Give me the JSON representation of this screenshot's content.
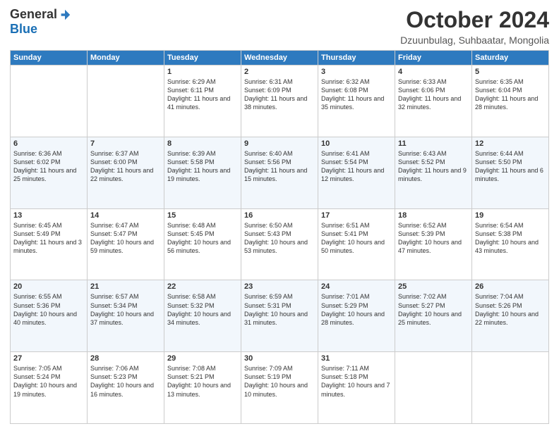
{
  "header": {
    "logo_general": "General",
    "logo_blue": "Blue",
    "month": "October 2024",
    "location": "Dzuunbulag, Suhbaatar, Mongolia"
  },
  "days_of_week": [
    "Sunday",
    "Monday",
    "Tuesday",
    "Wednesday",
    "Thursday",
    "Friday",
    "Saturday"
  ],
  "weeks": [
    [
      {
        "day": "",
        "sunrise": "",
        "sunset": "",
        "daylight": ""
      },
      {
        "day": "",
        "sunrise": "",
        "sunset": "",
        "daylight": ""
      },
      {
        "day": "1",
        "sunrise": "Sunrise: 6:29 AM",
        "sunset": "Sunset: 6:11 PM",
        "daylight": "Daylight: 11 hours and 41 minutes."
      },
      {
        "day": "2",
        "sunrise": "Sunrise: 6:31 AM",
        "sunset": "Sunset: 6:09 PM",
        "daylight": "Daylight: 11 hours and 38 minutes."
      },
      {
        "day": "3",
        "sunrise": "Sunrise: 6:32 AM",
        "sunset": "Sunset: 6:08 PM",
        "daylight": "Daylight: 11 hours and 35 minutes."
      },
      {
        "day": "4",
        "sunrise": "Sunrise: 6:33 AM",
        "sunset": "Sunset: 6:06 PM",
        "daylight": "Daylight: 11 hours and 32 minutes."
      },
      {
        "day": "5",
        "sunrise": "Sunrise: 6:35 AM",
        "sunset": "Sunset: 6:04 PM",
        "daylight": "Daylight: 11 hours and 28 minutes."
      }
    ],
    [
      {
        "day": "6",
        "sunrise": "Sunrise: 6:36 AM",
        "sunset": "Sunset: 6:02 PM",
        "daylight": "Daylight: 11 hours and 25 minutes."
      },
      {
        "day": "7",
        "sunrise": "Sunrise: 6:37 AM",
        "sunset": "Sunset: 6:00 PM",
        "daylight": "Daylight: 11 hours and 22 minutes."
      },
      {
        "day": "8",
        "sunrise": "Sunrise: 6:39 AM",
        "sunset": "Sunset: 5:58 PM",
        "daylight": "Daylight: 11 hours and 19 minutes."
      },
      {
        "day": "9",
        "sunrise": "Sunrise: 6:40 AM",
        "sunset": "Sunset: 5:56 PM",
        "daylight": "Daylight: 11 hours and 15 minutes."
      },
      {
        "day": "10",
        "sunrise": "Sunrise: 6:41 AM",
        "sunset": "Sunset: 5:54 PM",
        "daylight": "Daylight: 11 hours and 12 minutes."
      },
      {
        "day": "11",
        "sunrise": "Sunrise: 6:43 AM",
        "sunset": "Sunset: 5:52 PM",
        "daylight": "Daylight: 11 hours and 9 minutes."
      },
      {
        "day": "12",
        "sunrise": "Sunrise: 6:44 AM",
        "sunset": "Sunset: 5:50 PM",
        "daylight": "Daylight: 11 hours and 6 minutes."
      }
    ],
    [
      {
        "day": "13",
        "sunrise": "Sunrise: 6:45 AM",
        "sunset": "Sunset: 5:49 PM",
        "daylight": "Daylight: 11 hours and 3 minutes."
      },
      {
        "day": "14",
        "sunrise": "Sunrise: 6:47 AM",
        "sunset": "Sunset: 5:47 PM",
        "daylight": "Daylight: 10 hours and 59 minutes."
      },
      {
        "day": "15",
        "sunrise": "Sunrise: 6:48 AM",
        "sunset": "Sunset: 5:45 PM",
        "daylight": "Daylight: 10 hours and 56 minutes."
      },
      {
        "day": "16",
        "sunrise": "Sunrise: 6:50 AM",
        "sunset": "Sunset: 5:43 PM",
        "daylight": "Daylight: 10 hours and 53 minutes."
      },
      {
        "day": "17",
        "sunrise": "Sunrise: 6:51 AM",
        "sunset": "Sunset: 5:41 PM",
        "daylight": "Daylight: 10 hours and 50 minutes."
      },
      {
        "day": "18",
        "sunrise": "Sunrise: 6:52 AM",
        "sunset": "Sunset: 5:39 PM",
        "daylight": "Daylight: 10 hours and 47 minutes."
      },
      {
        "day": "19",
        "sunrise": "Sunrise: 6:54 AM",
        "sunset": "Sunset: 5:38 PM",
        "daylight": "Daylight: 10 hours and 43 minutes."
      }
    ],
    [
      {
        "day": "20",
        "sunrise": "Sunrise: 6:55 AM",
        "sunset": "Sunset: 5:36 PM",
        "daylight": "Daylight: 10 hours and 40 minutes."
      },
      {
        "day": "21",
        "sunrise": "Sunrise: 6:57 AM",
        "sunset": "Sunset: 5:34 PM",
        "daylight": "Daylight: 10 hours and 37 minutes."
      },
      {
        "day": "22",
        "sunrise": "Sunrise: 6:58 AM",
        "sunset": "Sunset: 5:32 PM",
        "daylight": "Daylight: 10 hours and 34 minutes."
      },
      {
        "day": "23",
        "sunrise": "Sunrise: 6:59 AM",
        "sunset": "Sunset: 5:31 PM",
        "daylight": "Daylight: 10 hours and 31 minutes."
      },
      {
        "day": "24",
        "sunrise": "Sunrise: 7:01 AM",
        "sunset": "Sunset: 5:29 PM",
        "daylight": "Daylight: 10 hours and 28 minutes."
      },
      {
        "day": "25",
        "sunrise": "Sunrise: 7:02 AM",
        "sunset": "Sunset: 5:27 PM",
        "daylight": "Daylight: 10 hours and 25 minutes."
      },
      {
        "day": "26",
        "sunrise": "Sunrise: 7:04 AM",
        "sunset": "Sunset: 5:26 PM",
        "daylight": "Daylight: 10 hours and 22 minutes."
      }
    ],
    [
      {
        "day": "27",
        "sunrise": "Sunrise: 7:05 AM",
        "sunset": "Sunset: 5:24 PM",
        "daylight": "Daylight: 10 hours and 19 minutes."
      },
      {
        "day": "28",
        "sunrise": "Sunrise: 7:06 AM",
        "sunset": "Sunset: 5:23 PM",
        "daylight": "Daylight: 10 hours and 16 minutes."
      },
      {
        "day": "29",
        "sunrise": "Sunrise: 7:08 AM",
        "sunset": "Sunset: 5:21 PM",
        "daylight": "Daylight: 10 hours and 13 minutes."
      },
      {
        "day": "30",
        "sunrise": "Sunrise: 7:09 AM",
        "sunset": "Sunset: 5:19 PM",
        "daylight": "Daylight: 10 hours and 10 minutes."
      },
      {
        "day": "31",
        "sunrise": "Sunrise: 7:11 AM",
        "sunset": "Sunset: 5:18 PM",
        "daylight": "Daylight: 10 hours and 7 minutes."
      },
      {
        "day": "",
        "sunrise": "",
        "sunset": "",
        "daylight": ""
      },
      {
        "day": "",
        "sunrise": "",
        "sunset": "",
        "daylight": ""
      }
    ]
  ]
}
